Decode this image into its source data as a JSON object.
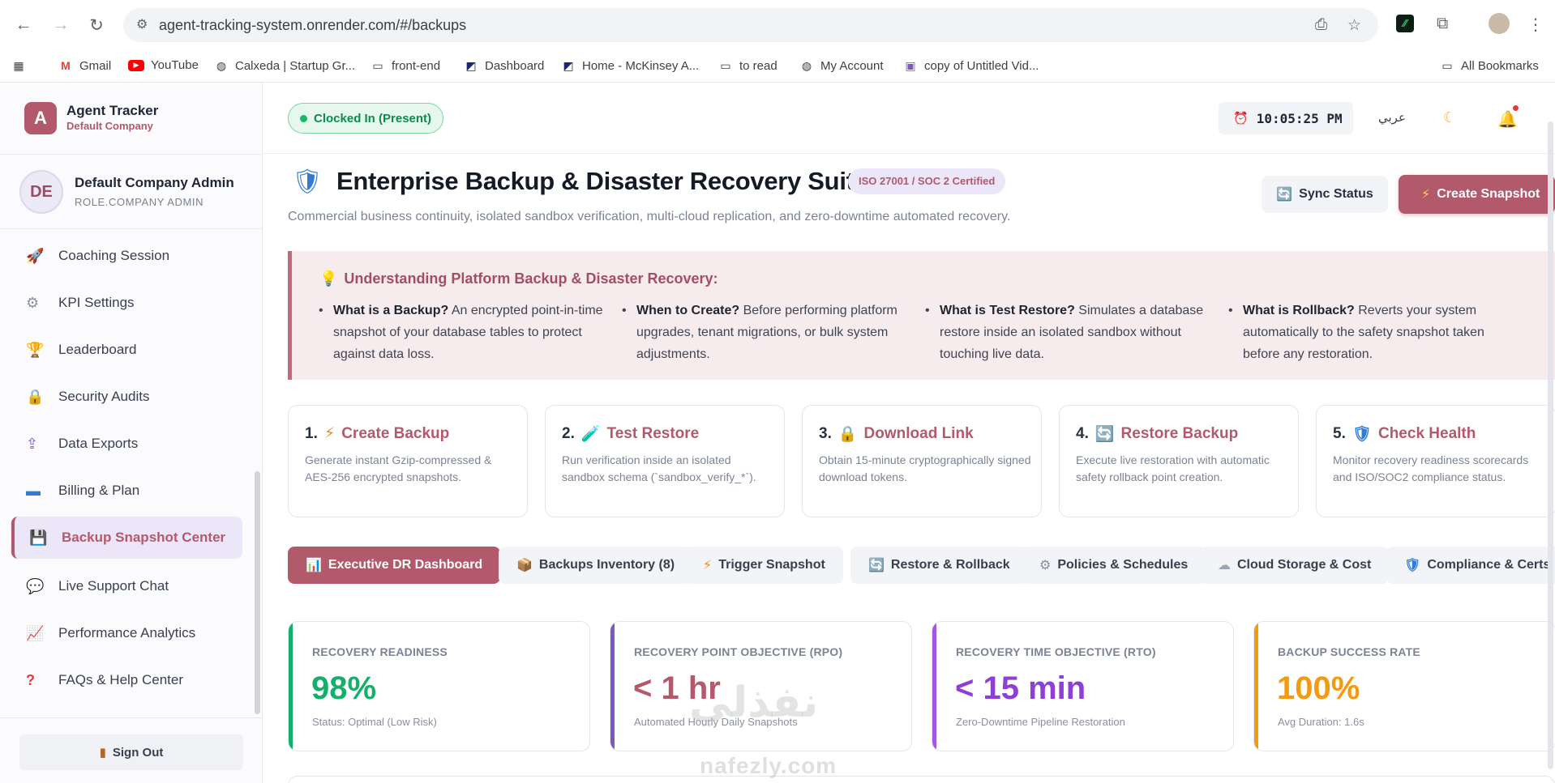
{
  "browser": {
    "url": "agent-tracking-system.onrender.com/#/backups",
    "bookmarks": [
      {
        "label": "Gmail",
        "icon": "gmail-icon"
      },
      {
        "label": "YouTube",
        "icon": "youtube-icon"
      },
      {
        "label": "Calxeda | Startup Gr...",
        "icon": "globe-icon"
      },
      {
        "label": "front-end",
        "icon": "folder-icon"
      },
      {
        "label": "Dashboard",
        "icon": "mckinsey-icon"
      },
      {
        "label": "Home - McKinsey A...",
        "icon": "mckinsey-icon"
      },
      {
        "label": "to read",
        "icon": "folder-icon"
      },
      {
        "label": "My Account",
        "icon": "globe-icon"
      },
      {
        "label": "copy of Untitled Vid...",
        "icon": "video-icon"
      }
    ],
    "all_bookmarks": "All Bookmarks"
  },
  "sidebar": {
    "brand_letter": "A",
    "brand_name": "Agent Tracker",
    "brand_company": "Default Company",
    "user_initials": "DE",
    "user_name": "Default Company Admin",
    "user_role": "ROLE.COMPANY ADMIN",
    "items": [
      {
        "label": "Coaching Session",
        "icon": "rocket-icon"
      },
      {
        "label": "KPI Settings",
        "icon": "gear-icon"
      },
      {
        "label": "Leaderboard",
        "icon": "trophy-icon"
      },
      {
        "label": "Security Audits",
        "icon": "lock-icon"
      },
      {
        "label": "Data Exports",
        "icon": "export-icon"
      },
      {
        "label": "Billing & Plan",
        "icon": "credit-card-icon"
      },
      {
        "label": "Backup Snapshot Center",
        "icon": "floppy-disk-icon"
      },
      {
        "label": "Live Support Chat",
        "icon": "chat-icon"
      },
      {
        "label": "Performance Analytics",
        "icon": "chart-icon"
      },
      {
        "label": "FAQs & Help Center",
        "icon": "question-icon"
      }
    ],
    "active_index": 6,
    "signout": "Sign Out"
  },
  "topbar": {
    "clock_status": "Clocked In (Present)",
    "time": "10:05:25 PM",
    "language": "عربي"
  },
  "header": {
    "title": "Enterprise Backup & Disaster Recovery Suite",
    "badge": "ISO 27001 / SOC 2 Certified",
    "subtitle": "Commercial business continuity, isolated sandbox verification, multi-cloud replication, and zero-downtime automated recovery.",
    "sync_label": "Sync Status",
    "create_label": "Create Snapshot"
  },
  "info": {
    "title": "Understanding Platform Backup & Disaster Recovery:",
    "items": [
      {
        "q": "What is a Backup?",
        "a": " An encrypted point-in-time snapshot of your database tables to protect against data loss."
      },
      {
        "q": "When to Create?",
        "a": " Before performing platform upgrades, tenant migrations, or bulk system adjustments."
      },
      {
        "q": "What is Test Restore?",
        "a": " Simulates a database restore inside an isolated sandbox without touching live data."
      },
      {
        "q": "What is Rollback?",
        "a": " Reverts your system automatically to the safety snapshot taken before any restoration."
      }
    ]
  },
  "steps": [
    {
      "num": "1.",
      "title": "Create Backup",
      "icon": "bolt-icon",
      "desc": "Generate instant Gzip-compressed & AES-256 encrypted snapshots."
    },
    {
      "num": "2.",
      "title": "Test Restore",
      "icon": "test-tube-icon",
      "desc": "Run verification inside an isolated sandbox schema (`sandbox_verify_*`)."
    },
    {
      "num": "3.",
      "title": "Download Link",
      "icon": "lock-icon",
      "desc": "Obtain 15-minute cryptographically signed download tokens."
    },
    {
      "num": "4.",
      "title": "Restore Backup",
      "icon": "refresh-icon",
      "desc": "Execute live restoration with automatic safety rollback point creation."
    },
    {
      "num": "5.",
      "title": "Check Health",
      "icon": "shield-icon",
      "desc": "Monitor recovery readiness scorecards and ISO/SOC2 compliance status."
    }
  ],
  "tabs": [
    {
      "label": "Executive DR Dashboard",
      "icon": "chart-icon"
    },
    {
      "label": "Backups Inventory (8)",
      "icon": "box-icon"
    },
    {
      "label": "Trigger Snapshot",
      "icon": "bolt-icon"
    },
    {
      "label": "Restore & Rollback",
      "icon": "refresh-icon"
    },
    {
      "label": "Policies & Schedules",
      "icon": "gear-icon"
    },
    {
      "label": "Cloud Storage & Cost",
      "icon": "cloud-icon"
    },
    {
      "label": "Compliance & Certs",
      "icon": "shield-icon"
    }
  ],
  "kpis": [
    {
      "label": "RECOVERY READINESS",
      "value": "98%",
      "sub": "Status: Optimal (Low Risk)",
      "color": "#14b06a"
    },
    {
      "label": "RECOVERY POINT OBJECTIVE (RPO)",
      "value": "< 1 hr",
      "sub": "Automated Hourly Daily Snapshots",
      "color": "#b25a6c"
    },
    {
      "label": "RECOVERY TIME OBJECTIVE (RTO)",
      "value": "< 15 min",
      "sub": "Zero-Downtime Pipeline Restoration",
      "color": "#8e3fd6"
    },
    {
      "label": "BACKUP SUCCESS RATE",
      "value": "100%",
      "sub": "Avg Duration: 1.6s",
      "color": "#f39a12"
    }
  ],
  "watermark": {
    "arabic": "نفذلي",
    "latin": "nafezly.com"
  },
  "colors": {
    "accent": "#b25a6c",
    "success": "#14b06a",
    "purple": "#8e3fd6",
    "orange": "#f39a12"
  }
}
